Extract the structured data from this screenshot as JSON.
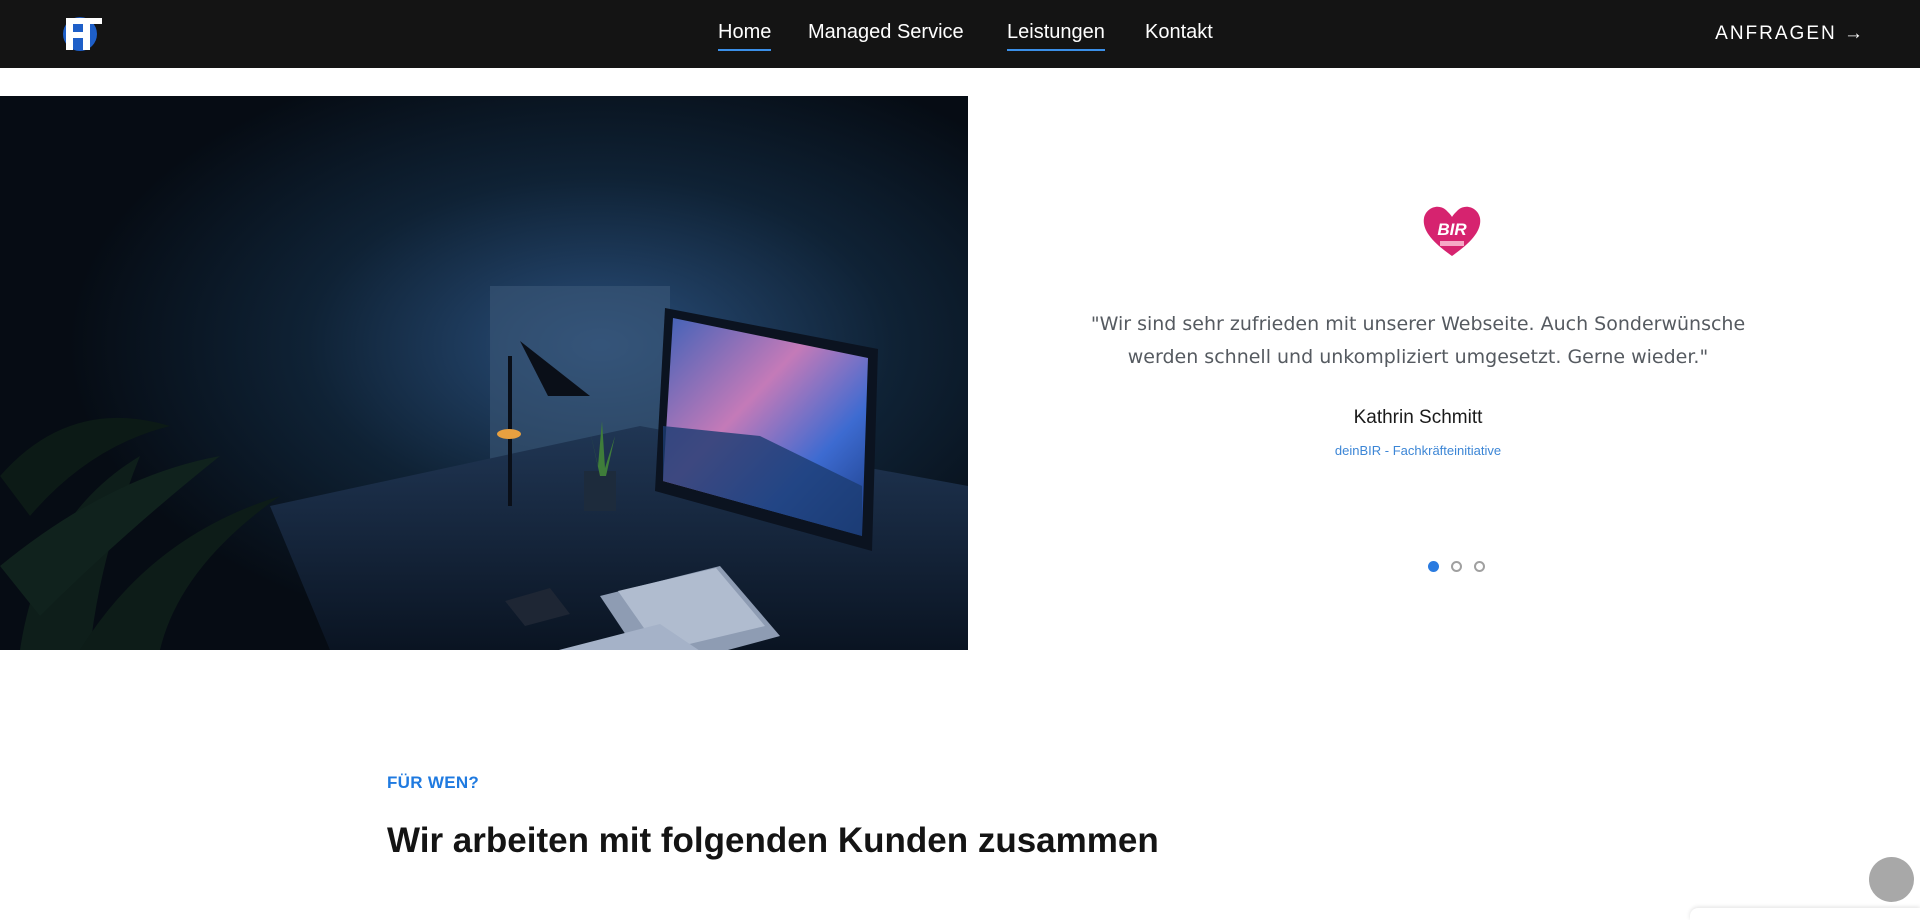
{
  "navbar": {
    "logo_text": "PT",
    "links": [
      {
        "label": "Home"
      },
      {
        "label": "Managed Service"
      },
      {
        "label": "Leistungen"
      },
      {
        "label": "Kontakt"
      }
    ],
    "cta_label": "ANFRAGEN →"
  },
  "testimonial": {
    "brand_logo_text": "BIR",
    "quote": "\"Wir sind sehr zufrieden mit unserer Webseite. Auch Sonderwünsche werden schnell und unkompliziert umgesetzt. Gerne wieder.\"",
    "author": "Kathrin Schmitt",
    "company": "deinBIR - Fachkräfteinitiative",
    "slide_count": 3,
    "active_slide": 1
  },
  "section": {
    "eyebrow": "FÜR WEN?",
    "title": "Wir arbeiten mit folgenden Kunden zusammen"
  },
  "colors": {
    "navbar_bg": "#141414",
    "accent": "#1f7ae0",
    "brand_pink": "#d6236f"
  },
  "icons": {
    "logo": "pt-logo-icon",
    "brand": "heart-logo-icon",
    "scroll": "scroll-to-top-icon"
  }
}
